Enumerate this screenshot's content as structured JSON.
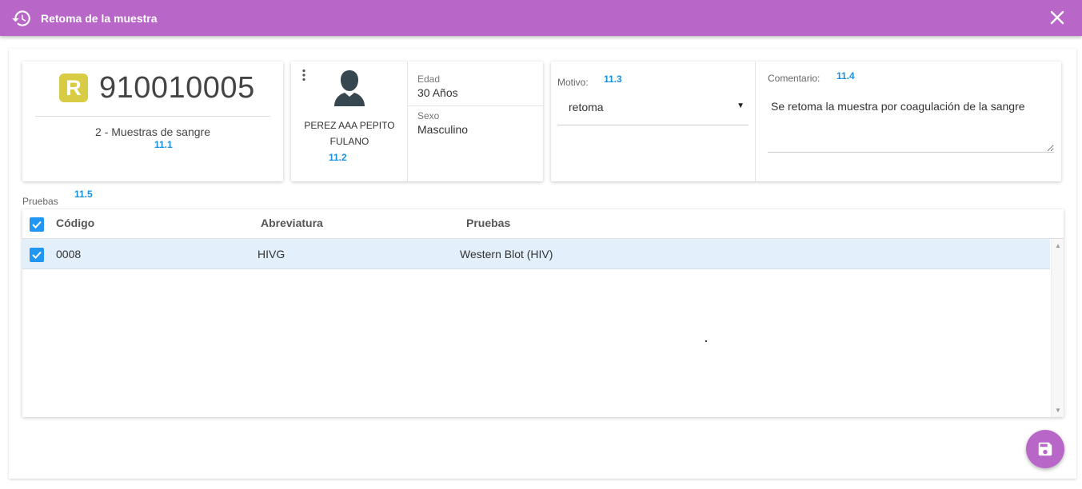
{
  "header": {
    "title": "Retoma de la muestra",
    "bg_color": "#b866c8"
  },
  "sample": {
    "badge": "R",
    "number": "910010005",
    "description": "2 - Muestras de sangre",
    "annotation": "11.1"
  },
  "patient": {
    "name_line1": "PEREZ AAA PEPITO",
    "name_line2": "FULANO",
    "annotation": "11.2",
    "age_label": "Edad",
    "age_value": "30 Años",
    "sex_label": "Sexo",
    "sex_value": "Masculino"
  },
  "motivo": {
    "label": "Motivo:",
    "annotation": "11.3",
    "value": "retoma"
  },
  "comentario": {
    "label": "Comentario:",
    "annotation": "11.4",
    "value": "Se retoma la muestra por coagulación de la sangre"
  },
  "pruebas": {
    "label": "Pruebas",
    "annotation": "11.5",
    "columns": [
      "Código",
      "Abreviatura",
      "Pruebas"
    ],
    "rows": [
      {
        "checked": true,
        "codigo": "0008",
        "abreviatura": "HIVG",
        "prueba": "Western Blot (HIV)"
      }
    ]
  }
}
